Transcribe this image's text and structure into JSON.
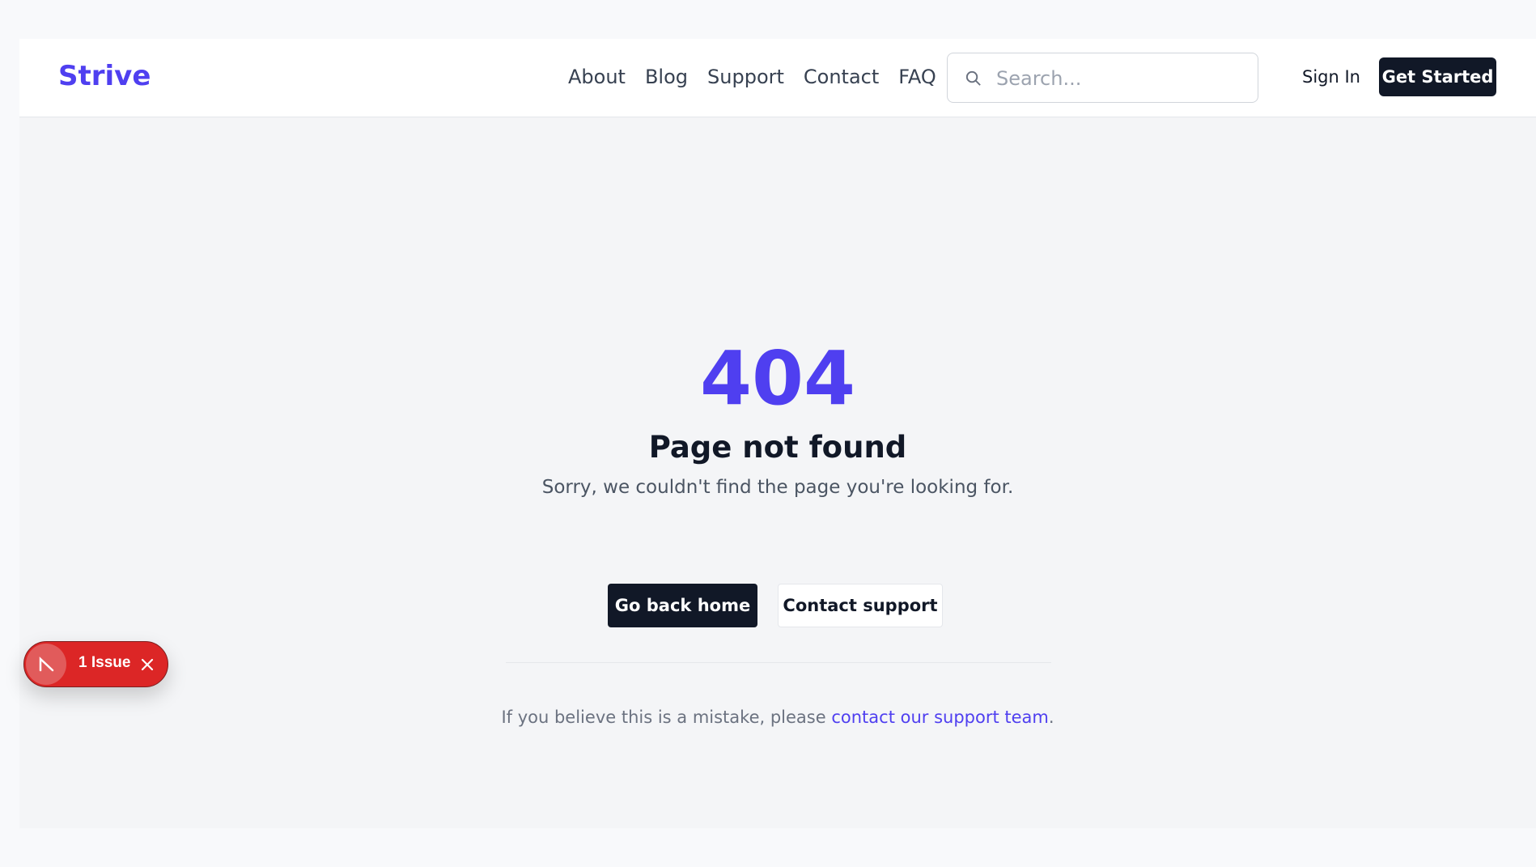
{
  "header": {
    "brand": "Strive",
    "nav": [
      "About",
      "Blog",
      "Support",
      "Contact",
      "FAQ"
    ],
    "search_placeholder": "Search...",
    "sign_in": "Sign In",
    "get_started": "Get Started"
  },
  "error": {
    "code": "404",
    "title": "Page not found",
    "message": "Sorry, we couldn't find the page you're looking for.",
    "primary_button": "Go back home",
    "secondary_button": "Contact support",
    "notice_prefix": "If you believe this is a mistake, please ",
    "notice_link": "contact our support team",
    "notice_suffix": "."
  },
  "issue_badge": {
    "label": "1 Issue"
  },
  "colors": {
    "brand": "#4f3ff0",
    "dark": "#111827",
    "issue": "#dc2626"
  },
  "icons": {
    "search": "search-icon",
    "issue": "issue-icon",
    "close": "close-icon"
  }
}
